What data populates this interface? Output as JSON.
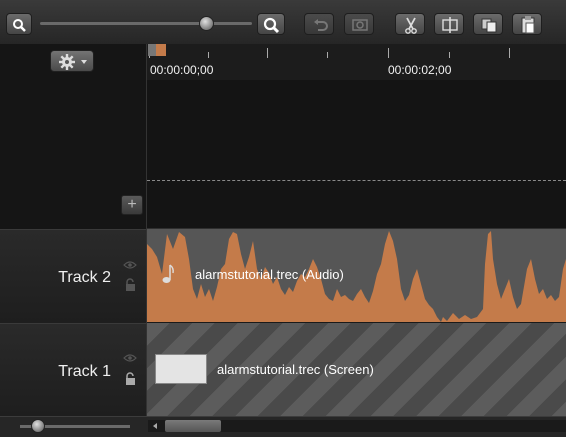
{
  "toolbar": {
    "zoom_level": 0.75,
    "icons": [
      "zoom-out-icon",
      "zoom-in-icon",
      "undo-icon",
      "redo-icon",
      "cut-icon",
      "split-icon",
      "copy-icon",
      "paste-icon"
    ]
  },
  "timeline": {
    "timecodes": [
      "00:00:00;00",
      "00:00:02;00"
    ],
    "clip_color": "#c47b4a"
  },
  "tracks": [
    {
      "label": "Track 2",
      "clip": "alarmstutorial.trec (Audio)"
    },
    {
      "label": "Track 1",
      "clip": "alarmstutorial.trec (Screen)"
    }
  ],
  "bottom": {
    "zoom_level": 0.15,
    "scroll_position": 0.05
  }
}
